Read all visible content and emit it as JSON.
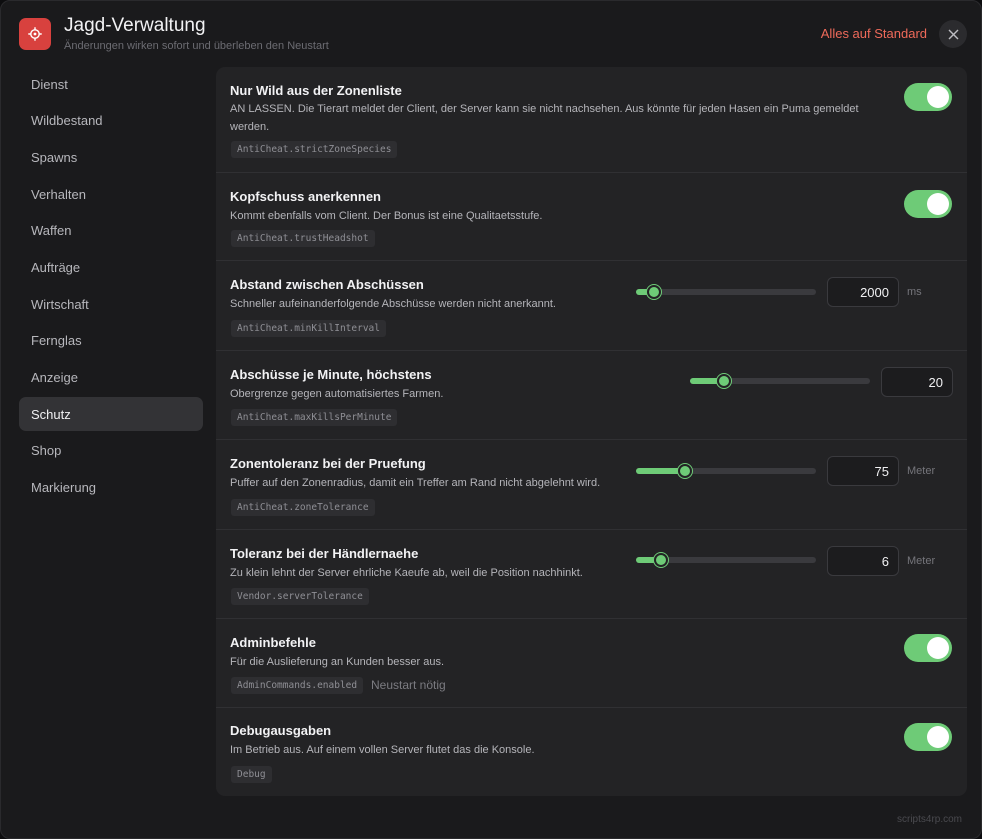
{
  "app": {
    "title": "Jagd-Verwaltung",
    "subtitle": "Änderungen wirken sofort und überleben den Neustart",
    "reset_label": "Alles auf Standard",
    "icon": "gear-icon",
    "brand": "scripts4rp.com"
  },
  "sidebar": {
    "items": [
      {
        "label": "Dienst"
      },
      {
        "label": "Wildbestand"
      },
      {
        "label": "Spawns"
      },
      {
        "label": "Verhalten"
      },
      {
        "label": "Waffen"
      },
      {
        "label": "Aufträge"
      },
      {
        "label": "Wirtschaft"
      },
      {
        "label": "Fernglas"
      },
      {
        "label": "Anzeige"
      },
      {
        "label": "Schutz",
        "active": true
      },
      {
        "label": "Shop"
      },
      {
        "label": "Markierung"
      }
    ]
  },
  "settings": [
    {
      "title": "Nur Wild aus der Zonenliste",
      "desc_line1": "AN LASSEN. Die Tierart meldet der Client, der Server kann sie nicht nachsehen. Aus könnte für jeden Hasen ein Puma gemeldet",
      "desc_line2": "werden.",
      "key": "AntiCheat.strictZoneSpecies",
      "control": "toggle",
      "enabled": true
    },
    {
      "title": "Kopfschuss anerkennen",
      "desc_line1": "Kommt ebenfalls vom Client. Der Bonus ist eine Qualitaetsstufe.",
      "key": "AntiCheat.trustHeadshot",
      "control": "toggle",
      "enabled": true
    },
    {
      "title": "Abstand zwischen Abschüssen",
      "desc_line1": "Schneller aufeinanderfolgende Abschüsse werden nicht anerkannt.",
      "key": "AntiCheat.minKillInterval",
      "control": "slider",
      "value": "2000",
      "fraction": 0.1,
      "unit": "ms"
    },
    {
      "title": "Abschüsse je Minute, höchstens",
      "desc_line1": "Obergrenze gegen automatisiertes Farmen.",
      "key": "AntiCheat.maxKillsPerMinute",
      "control": "slider",
      "value": "20",
      "fraction": 0.19
    },
    {
      "title": "Zonentoleranz bei der Pruefung",
      "desc_line1": "Puffer auf den Zonenradius, damit ein Treffer am Rand nicht abgelehnt wird.",
      "key": "AntiCheat.zoneTolerance",
      "control": "slider",
      "value": "75",
      "fraction": 0.27,
      "unit": "Meter"
    },
    {
      "title": "Toleranz bei der Händlernaehe",
      "desc_line1": "Zu klein lehnt der Server ehrliche Kaeufe ab, weil die Position nachhinkt.",
      "key": "Vendor.serverTolerance",
      "control": "slider",
      "value": "6",
      "fraction": 0.14,
      "unit": "Meter"
    },
    {
      "title": "Adminbefehle",
      "desc_line1": "Für die Auslieferung an Kunden besser aus.",
      "key": "AdminCommands.enabled",
      "note": "Neustart nötig",
      "control": "toggle",
      "enabled": true
    },
    {
      "title": "Debugausgaben",
      "desc_line1": "Im Betrieb aus. Auf einem vollen Server flutet das die Konsole.",
      "key": "Debug",
      "control": "toggle",
      "enabled": true
    }
  ],
  "colors": {
    "accent": "#6ecb77",
    "danger": "#ef6a5a",
    "app_icon": "#d8413e"
  }
}
